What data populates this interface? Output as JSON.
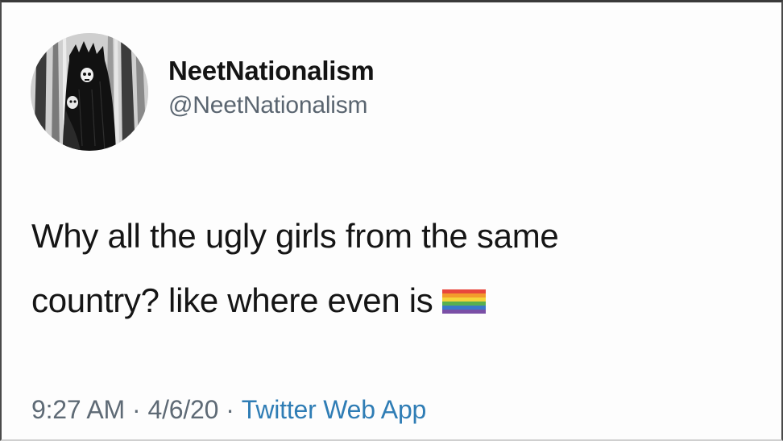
{
  "tweet": {
    "display_name": "NeetNationalism",
    "handle": "@NeetNationalism",
    "text_line1": "Why all the ugly girls from the same",
    "text_line2": "country? like where even is",
    "emoji": "rainbow-flag-icon",
    "time": "9:27 AM",
    "separator": "·",
    "date": "4/6/20",
    "source": "Twitter Web App"
  },
  "colors": {
    "text": "#151515",
    "secondary": "#5e6a75",
    "link": "#2f7db5",
    "flag": [
      "#e8463c",
      "#f39a2c",
      "#f5d33a",
      "#58b04f",
      "#3b78c9",
      "#7a4fa6"
    ]
  }
}
